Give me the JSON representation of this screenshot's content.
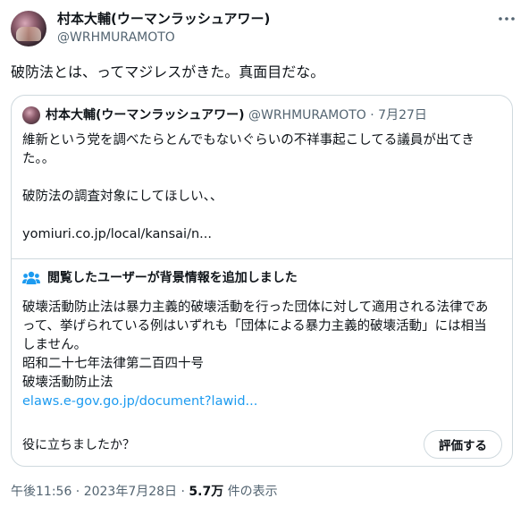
{
  "author": {
    "name": "村本大輔(ウーマンラッシュアワー)",
    "handle": "@WRHMURAMOTO"
  },
  "tweet": {
    "text": "破防法とは、ってマジレスがきた。真面目だな。"
  },
  "quote": {
    "name": "村本大輔(ウーマンラッシュアワー)",
    "handle_date": "@WRHMURAMOTO · 7月27日",
    "line1": "維新という党を調べたらとんでもないぐらいの不祥事起こしてる議員が出てき",
    "line2": "た。。",
    "line3": "破防法の調査対象にしてほしい、、",
    "link": "yomiuri.co.jp/local/kansai/n..."
  },
  "community_note": {
    "heading": "閲覧したユーザーが背景情報を追加しました",
    "line1": "破壊活動防止法は暴力主義的破壊活動を行った団体に対して適用される法律であ",
    "line2": "って、挙げられている例はいずれも「団体による暴力主義的破壊活動」には相当",
    "line3": "しません。",
    "source1": "昭和二十七年法律第二百四十号",
    "source2": "破壊活動防止法",
    "url": "elaws.e-gov.go.jp/document?lawid...",
    "helpful_question": "役に立ちましたか？",
    "rate_button": "評価する",
    "accent": "#1d9bf0"
  },
  "footer": {
    "time_date": "午後11:56 · 2023年7月28日 · ",
    "views_count": "5.7万",
    "views_label": " 件の表示"
  }
}
